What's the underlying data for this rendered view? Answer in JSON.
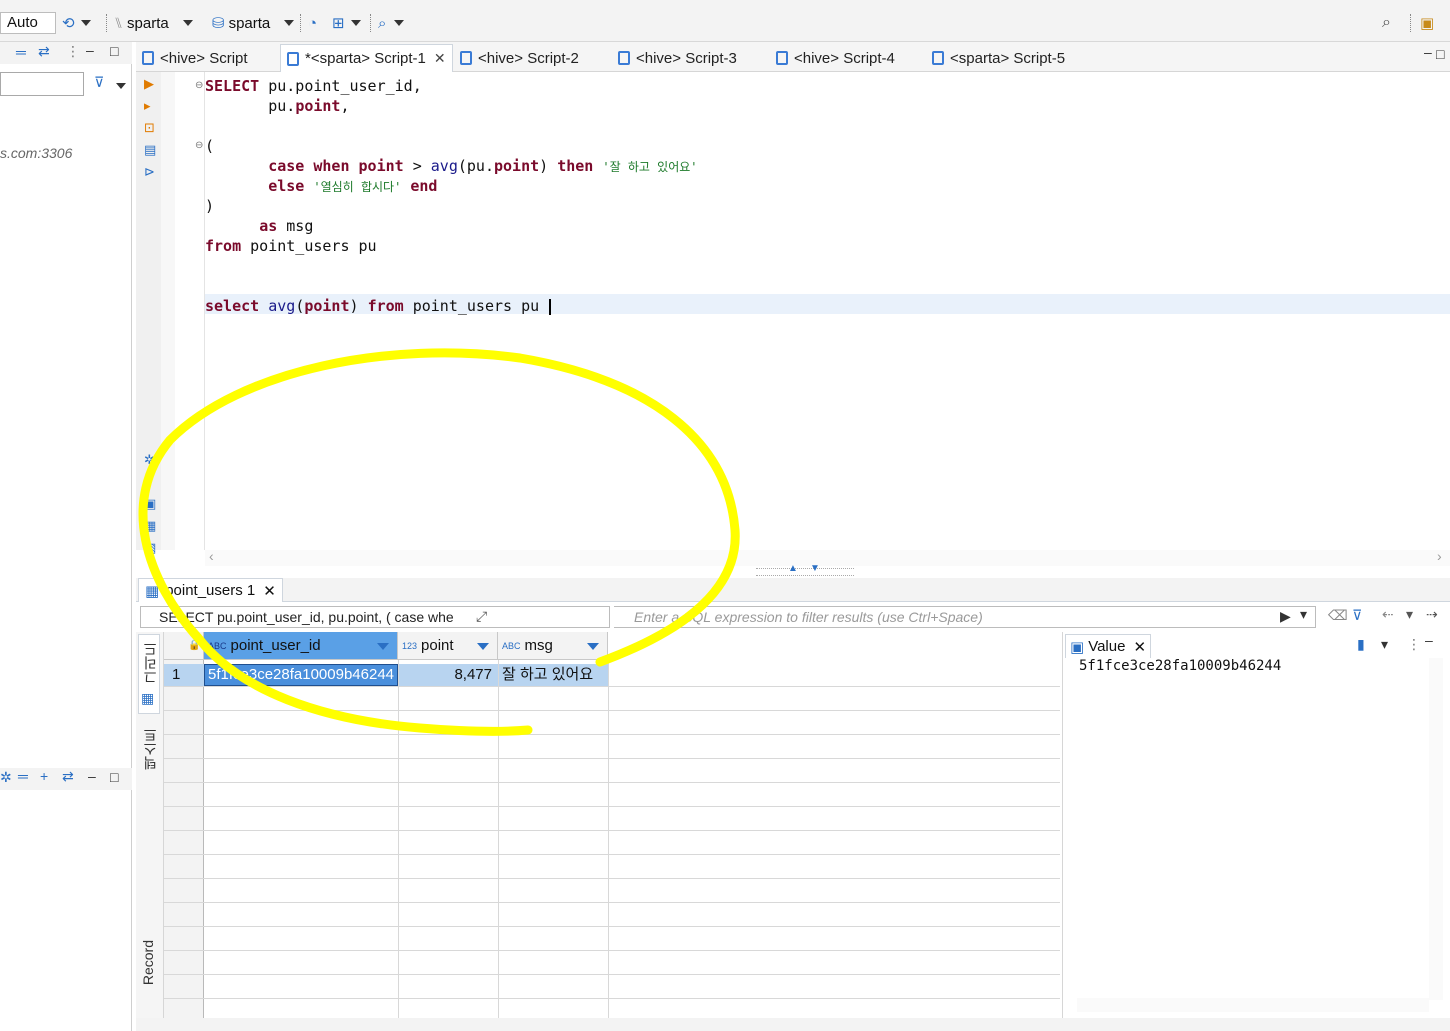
{
  "toolbar": {
    "transaction_mode": "Auto",
    "datasource": "sparta",
    "schema": "sparta"
  },
  "left_panel": {
    "connection_fragment": "s.com:3306"
  },
  "editor_tabs": [
    {
      "label": "<hive> Script",
      "active": false
    },
    {
      "label": "*<sparta> Script-1",
      "active": true
    },
    {
      "label": "<hive> Script-2",
      "active": false
    },
    {
      "label": "<hive> Script-3",
      "active": false
    },
    {
      "label": "<hive> Script-4",
      "active": false
    },
    {
      "label": "<sparta> Script-5",
      "active": false
    }
  ],
  "editor": {
    "lines": {
      "l1": {
        "kw": "SELECT",
        "rest": " pu.point_user_id,"
      },
      "l2": {
        "pre": "       pu.",
        "prop": "point",
        "post": ","
      },
      "l3": "(",
      "l4": {
        "kw1": "case",
        "kw2": "when",
        "prop": "point",
        "op": " > ",
        "fn": "avg",
        "arg_pre": "(pu.",
        "arg_prop": "point",
        "arg_post": ")",
        "kw3": "then",
        "str": "'잘 하고 있어요'"
      },
      "l5": {
        "kw": "else",
        "str": "'열심히 합시다'",
        "kw2": "end"
      },
      "l6": ")",
      "l7": {
        "kw": "as",
        "rest": " msg"
      },
      "l8": {
        "kw": "from",
        "rest": " point_users pu"
      },
      "l9": {
        "kw": "select",
        "fn": "avg",
        "prop": "point",
        "kw2": "from",
        "rest": " point_users pu "
      }
    }
  },
  "results": {
    "tab_label": "point_users 1",
    "sql_preview": "SELECT pu.point_user_id, pu.point, ( case whe",
    "filter_placeholder": "Enter a SQL expression to filter results (use Ctrl+Space)",
    "side_tabs": [
      "그리드",
      "텍스트",
      "Record"
    ],
    "columns": [
      {
        "type": "ABC",
        "name": "point_user_id"
      },
      {
        "type": "123",
        "name": "point"
      },
      {
        "type": "ABC",
        "name": "msg"
      }
    ],
    "rows": [
      {
        "num": "1",
        "point_user_id": "5f1fce3ce28fa10009b46244",
        "point": "8,477",
        "msg": "잘 하고 있어요"
      }
    ]
  },
  "value_panel": {
    "title": "Value",
    "content": "5f1fce3ce28fa10009b46244"
  },
  "colors": {
    "annotation": "#ffff00",
    "selected_header": "#5aa0e6",
    "selected_row": "#b8d4f0",
    "keyword": "#7a0a2b",
    "string": "#1d7a2a"
  }
}
